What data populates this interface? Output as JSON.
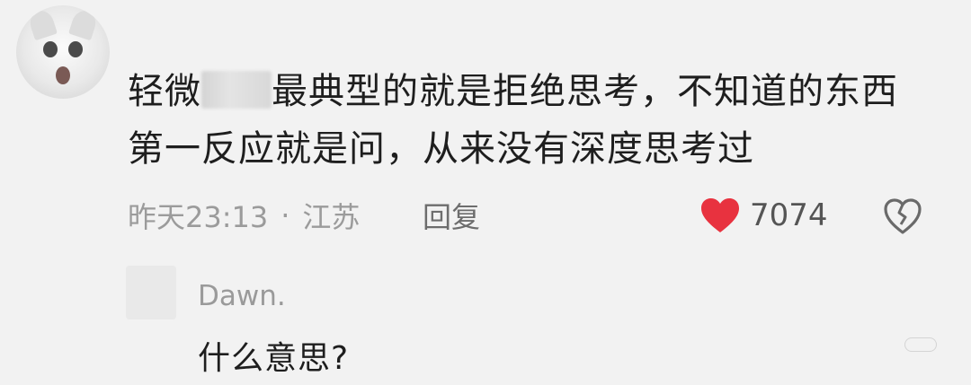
{
  "comment": {
    "text_before_redaction": "轻微",
    "text_after_redaction": "最典型的就是拒绝思考，不知道的东西",
    "text_line2": "第一反应就是问，从来没有深度思考过",
    "time": "昨天23:13",
    "separator": "·",
    "location": "江苏",
    "reply_label": "回复",
    "like_count": "7074",
    "colors": {
      "heart": "#e8323f",
      "text": "#1e1e1e",
      "meta": "#9b9b9b"
    },
    "icons": {
      "avatar": "cat-avatar",
      "like": "heart-icon",
      "dislike": "broken-heart-icon"
    }
  },
  "reply": {
    "username": "Dawn.",
    "text": "什么意思?"
  }
}
